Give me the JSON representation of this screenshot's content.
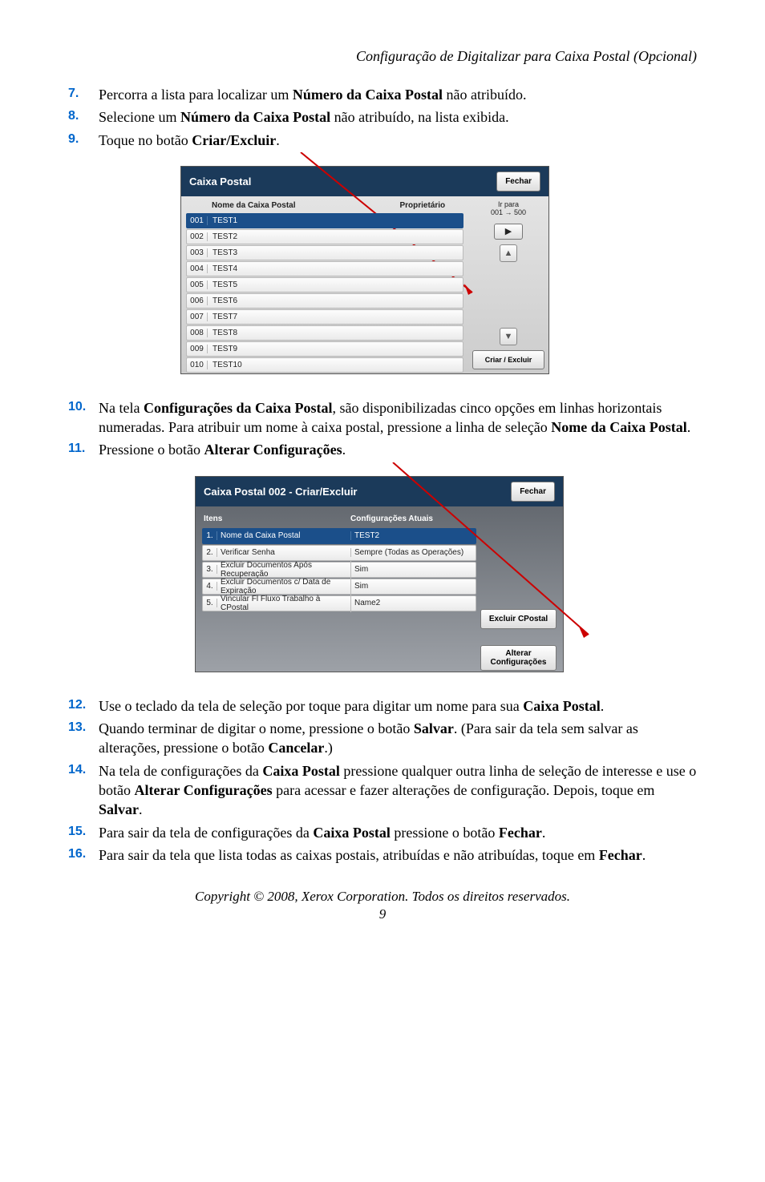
{
  "header_title": "Configuração de Digitalizar para Caixa Postal (Opcional)",
  "steps_a": [
    {
      "num": "7.",
      "html": "Percorra a lista para localizar um <strong>Número da Caixa Postal</strong> não atribuído."
    },
    {
      "num": "8.",
      "html": "Selecione um <strong>Número da Caixa Postal</strong> não atribuído, na lista exibida."
    },
    {
      "num": "9.",
      "html": "Toque no botão <strong>Criar/Excluir</strong>."
    }
  ],
  "panel1": {
    "title": "Caixa Postal",
    "close": "Fechar",
    "col_name": "Nome da Caixa Postal",
    "col_owner": "Proprietário",
    "irpara_l1": "Ir para",
    "irpara_l2": "001 → 500",
    "criar": "Criar / Excluir",
    "rows": [
      {
        "id": "001",
        "name": "TEST1",
        "selected": true
      },
      {
        "id": "002",
        "name": "TEST2"
      },
      {
        "id": "003",
        "name": "TEST3"
      },
      {
        "id": "004",
        "name": "TEST4"
      },
      {
        "id": "005",
        "name": "TEST5"
      },
      {
        "id": "006",
        "name": "TEST6"
      },
      {
        "id": "007",
        "name": "TEST7"
      },
      {
        "id": "008",
        "name": "TEST8"
      },
      {
        "id": "009",
        "name": "TEST9"
      },
      {
        "id": "010",
        "name": "TEST10"
      }
    ]
  },
  "steps_b": [
    {
      "num": "10.",
      "html": "Na tela <strong>Configurações da Caixa Postal</strong>, são disponibilizadas cinco opções em linhas horizontais numeradas. Para atribuir um nome à caixa postal, pressione a linha de seleção <strong>Nome da Caixa Postal</strong>."
    },
    {
      "num": "11.",
      "html": "Pressione o botão <strong>Alterar Configurações</strong>."
    }
  ],
  "panel2": {
    "title": "Caixa Postal 002 - Criar/Excluir",
    "close": "Fechar",
    "col_items": "Itens",
    "col_conf": "Configurações Atuais",
    "excluir": "Excluir CPostal",
    "alterar_l1": "Alterar",
    "alterar_l2": "Configurações",
    "rows": [
      {
        "n": "1.",
        "label": "Nome da Caixa Postal",
        "value": "TEST2",
        "selected": true
      },
      {
        "n": "2.",
        "label": "Verificar Senha",
        "value": "Sempre (Todas as Operações)"
      },
      {
        "n": "3.",
        "label": "Excluir Documentos Após Recuperação",
        "value": "Sim"
      },
      {
        "n": "4.",
        "label": "Excluir Documentos c/ Data de Expiração",
        "value": "Sim"
      },
      {
        "n": "5.",
        "label": "Vincular Fl Fluxo Trabalho à CPostal",
        "value": "Name2"
      }
    ]
  },
  "steps_c": [
    {
      "num": "12.",
      "html": "Use o teclado da tela de seleção por toque para digitar um nome para sua <strong>Caixa Postal</strong>."
    },
    {
      "num": "13.",
      "html": "Quando terminar de digitar o nome, pressione o botão <strong>Salvar</strong>. (Para sair da tela sem salvar as alterações, pressione o botão <strong>Cancelar</strong>.)"
    },
    {
      "num": "14.",
      "html": "Na tela de configurações da <strong>Caixa Postal</strong> pressione qualquer outra linha de seleção de interesse e use o botão <strong>Alterar Configurações</strong> para acessar e fazer alterações de configuração. Depois, toque em <strong>Salvar</strong>."
    },
    {
      "num": "15.",
      "html": "Para sair da tela de configurações da <strong>Caixa Postal</strong> pressione o botão <strong>Fechar</strong>."
    },
    {
      "num": "16.",
      "html": "Para sair da tela que lista todas as caixas postais, atribuídas e não atribuídas, toque em <strong>Fechar</strong>."
    }
  ],
  "copyright": "Copyright © 2008, Xerox Corporation. Todos os direitos reservados.",
  "pagenum": "9"
}
